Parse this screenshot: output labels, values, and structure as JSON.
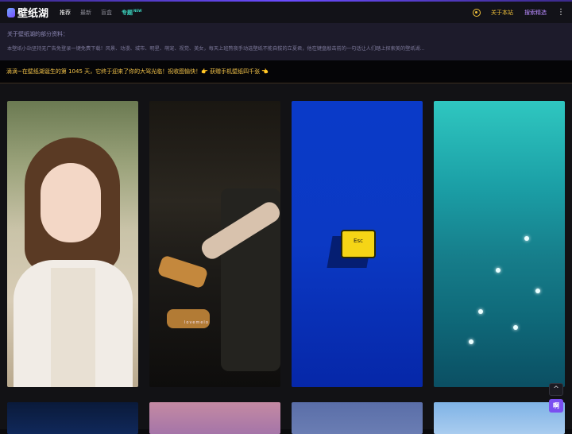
{
  "header": {
    "logo_text": "壁纸湖",
    "nav": [
      {
        "label": "推荐",
        "active": true
      },
      {
        "label": "最新",
        "active": false
      },
      {
        "label": "盲盒",
        "active": false
      }
    ],
    "special_nav": {
      "label": "专题",
      "badge": "NEW"
    },
    "about_label": "关于本站",
    "search_label": "搜索精选",
    "theme_icon": "theme-toggle-icon",
    "more_icon": "more-vertical-icon"
  },
  "notice": {
    "title": "关于壁纸湖的部分资料：",
    "body": "本壁纸小站坚持无广告免登录一键免费下载！风景、动漫、城市、明星、萌宠、视觉、美女，每天上班熬夜手动选壁纸不能自拔的立夏君，他在键盘敲击前的一句话让人们踏上探索美的壁纸湖..."
  },
  "announcement": {
    "text": "滴滴~在壁纸湖诞生的第 1045 天，它终于迎来了你的大驾光临！祝收图愉快！👉 获赠手机壁纸四千张 👈"
  },
  "wallpapers": {
    "esc_key_label": "Esc",
    "watermark": "lovemelo"
  },
  "floating": {
    "up_label": "^",
    "chat_label": "啊"
  },
  "colors": {
    "accent_yellow": "#f2c23a",
    "accent_purple": "#7b4ff0",
    "accent_teal": "#3cd6c2"
  }
}
